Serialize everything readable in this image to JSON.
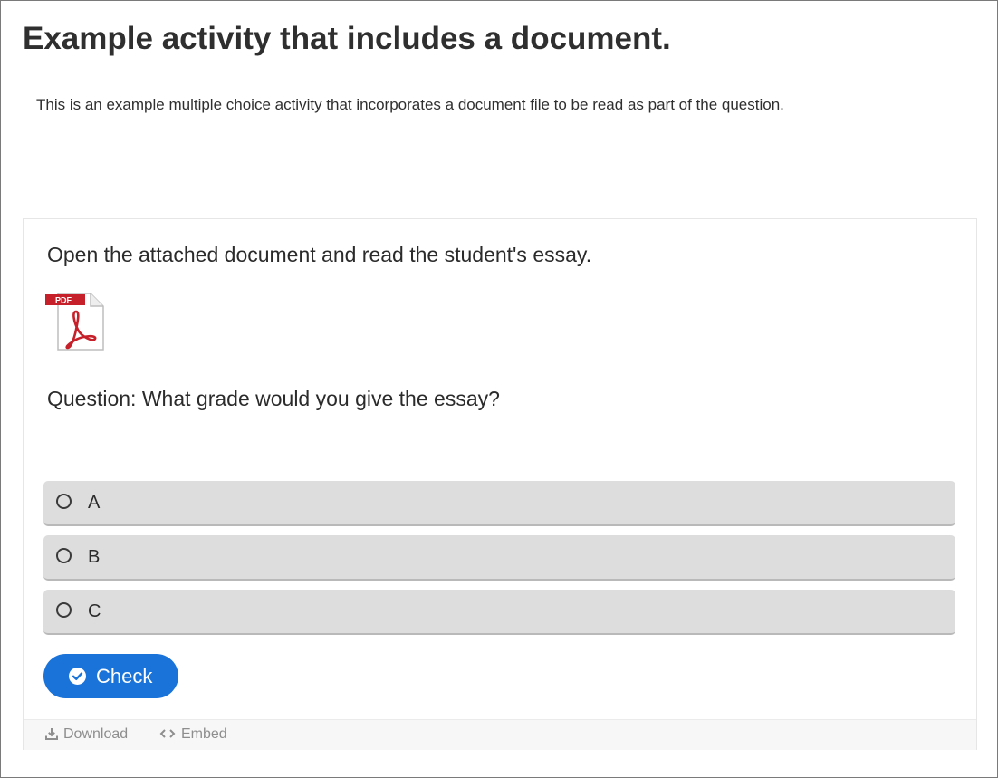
{
  "page": {
    "title": "Example activity that includes a document.",
    "intro": "This is an example multiple choice activity that incorporates a document file to be read as part of the question."
  },
  "activity": {
    "prompt": "Open the attached document and read the student's essay.",
    "attachment": {
      "icon": "pdf-file-icon",
      "badge": "PDF"
    },
    "question": "Question: What grade would you give the essay?",
    "answers": [
      {
        "label": "A",
        "selected": false
      },
      {
        "label": "B",
        "selected": false
      },
      {
        "label": "C",
        "selected": false
      }
    ],
    "check_button": {
      "label": "Check",
      "icon": "check-circle-icon"
    }
  },
  "footer": {
    "download": {
      "label": "Download",
      "icon": "download-icon"
    },
    "embed": {
      "label": "Embed",
      "icon": "code-icon"
    }
  },
  "colors": {
    "accent": "#1a73d9",
    "answer_bg": "#dddddd",
    "pdf_red": "#c6212a"
  }
}
